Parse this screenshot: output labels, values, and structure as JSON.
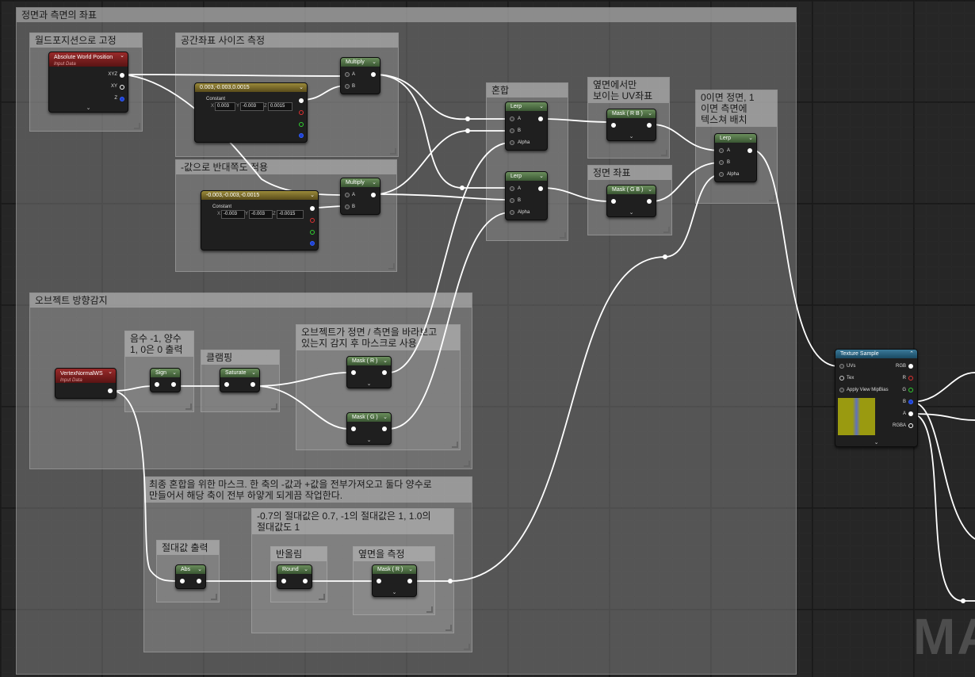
{
  "comments": {
    "main": "정면과 측면의 좌표",
    "world": "월드포지션으로 고정",
    "scale": "공간좌표 사이즈 측정",
    "negate": "-값으로 반대쪽도 적용",
    "mix": "혼합",
    "uv_side": "옆면에서만\n보이는 UV좌표",
    "front": "정면 좌표",
    "zero_front": "0이면 정면, 1\n이면 측면에\n텍스쳐 배치",
    "obj_dir": "오브젝트 방향감지",
    "sign_note": "음수 -1, 양수\n1, 0은 0 출력",
    "clamp": "클램핑",
    "mask_note": "오브젝트가 정면 / 측면을 바라보고\n있는지 감지 후 마스크로 사용",
    "final_note": "최종 혼합을 위한 마스크. 한 축의 -값과 +값을 전부가져오고 둘다 양수로\n만들어서 해당 축이 전부 하얗게 되게끔 작업한다.",
    "abs_note": "-0.7의 절대값은 0.7, -1의 절대값은 1, 1.0의\n절대값도 1",
    "abs_out": "절대값 출력",
    "round": "반올림",
    "side_measure": "옆면을 측정"
  },
  "nodes": {
    "abs_world_pos": {
      "title": "Absolute World Position",
      "sub": "Input Data",
      "pins": [
        "XYZ",
        "XY",
        "Z"
      ]
    },
    "const_pos": {
      "title": "0.003,-0.003,0.0015",
      "label": "Constant",
      "x": "0.003",
      "y": "-0.003",
      "z": "0.0015"
    },
    "const_neg": {
      "title": "-0.003,-0.003,-0.0015",
      "label": "Constant",
      "x": "-0.003",
      "y": "-0.003",
      "z": "-0.0015"
    },
    "multiply1": {
      "title": "Multiply",
      "a": "A",
      "b": "B"
    },
    "multiply2": {
      "title": "Multiply",
      "a": "A",
      "b": "B"
    },
    "lerp1": {
      "title": "Lerp",
      "a": "A",
      "b": "B",
      "alpha": "Alpha"
    },
    "lerp2": {
      "title": "Lerp",
      "a": "A",
      "b": "B",
      "alpha": "Alpha"
    },
    "lerp3": {
      "title": "Lerp",
      "a": "A",
      "b": "B",
      "alpha": "Alpha"
    },
    "mask_rb": {
      "title": "Mask ( R B )"
    },
    "mask_gb": {
      "title": "Mask ( G B )"
    },
    "vertex_normal": {
      "title": "VertexNormalWS",
      "sub": "Input Data"
    },
    "sign": {
      "title": "Sign"
    },
    "saturate": {
      "title": "Saturate"
    },
    "mask_r1": {
      "title": "Mask ( R )"
    },
    "mask_g": {
      "title": "Mask ( G )"
    },
    "abs": {
      "title": "Abs"
    },
    "round": {
      "title": "Round"
    },
    "mask_r2": {
      "title": "Mask ( R )"
    },
    "texture_sample": {
      "title": "Texture Sample",
      "pins_in": [
        "UVs",
        "Tex",
        "Apply View MipBias"
      ],
      "pins_out": [
        "RGB",
        "R",
        "G",
        "B",
        "A",
        "RGBA"
      ]
    }
  },
  "watermark": "MA"
}
